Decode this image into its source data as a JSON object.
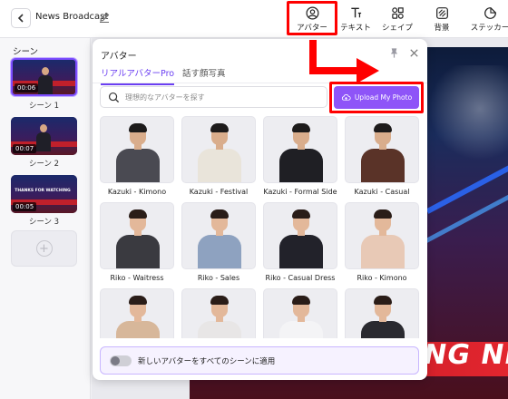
{
  "header": {
    "title": "News Broadcast",
    "tools": [
      {
        "label": "アバター",
        "icon": "avatar-icon"
      },
      {
        "label": "テキスト",
        "icon": "text-icon"
      },
      {
        "label": "シェイプ",
        "icon": "shape-icon"
      },
      {
        "label": "背景",
        "icon": "background-icon"
      },
      {
        "label": "ステッカー",
        "icon": "sticker-icon"
      }
    ]
  },
  "scenes": {
    "title": "シーン",
    "items": [
      {
        "label": "シーン 1",
        "duration": "00:06"
      },
      {
        "label": "シーン 2",
        "duration": "00:07"
      },
      {
        "label": "シーン 3",
        "duration": "00:05",
        "overlay": "THANKS FOR WATCHING"
      }
    ]
  },
  "panel": {
    "title": "アバター",
    "tabs": [
      "リアルアバターPro",
      "話す顔写真"
    ],
    "search_placeholder": "理想的なアバターを探す",
    "upload_label": "Upload My Photo",
    "avatars": [
      {
        "name": "Kazuki - Kimono",
        "outfit": "#4a4a52",
        "skin": "#d9ad8c",
        "hair": "#1d1b1b"
      },
      {
        "name": "Kazuki - Festival",
        "outfit": "#e9e4da",
        "skin": "#d9ad8c",
        "hair": "#1d1b1b"
      },
      {
        "name": "Kazuki - Formal Side",
        "outfit": "#1f1f24",
        "skin": "#d9ad8c",
        "hair": "#1d1b1b"
      },
      {
        "name": "Kazuki - Casual",
        "outfit": "#5a3328",
        "skin": "#d9ad8c",
        "hair": "#1d1b1b"
      },
      {
        "name": "Riko - Waitress",
        "outfit": "#3a3a40",
        "skin": "#e3b89a",
        "hair": "#2a1d18"
      },
      {
        "name": "Riko - Sales",
        "outfit": "#8ea2c0",
        "skin": "#e3b89a",
        "hair": "#2a1d18"
      },
      {
        "name": "Riko - Casual Dress",
        "outfit": "#22222a",
        "skin": "#e3b89a",
        "hair": "#2a1d18"
      },
      {
        "name": "Riko - Kimono",
        "outfit": "#e8c9b6",
        "skin": "#e3b89a",
        "hair": "#2a1d18"
      },
      {
        "name": "",
        "outfit": "#d7b79a",
        "skin": "#e3b89a",
        "hair": "#2a1d18"
      },
      {
        "name": "",
        "outfit": "#e8e6e6",
        "skin": "#e3b89a",
        "hair": "#2a1d18"
      },
      {
        "name": "",
        "outfit": "#f4f4f6",
        "skin": "#e3b89a",
        "hair": "#2a1d18"
      },
      {
        "name": "",
        "outfit": "#2a2a30",
        "skin": "#e3b89a",
        "hair": "#2a1d18"
      }
    ],
    "apply_all_label": "新しいアバターをすべてのシーンに適用",
    "apply_all_enabled": false
  },
  "canvas": {
    "ticker_text": "NG NE"
  },
  "colors": {
    "accent": "#8e54f8",
    "annotation": "#ff0000"
  }
}
